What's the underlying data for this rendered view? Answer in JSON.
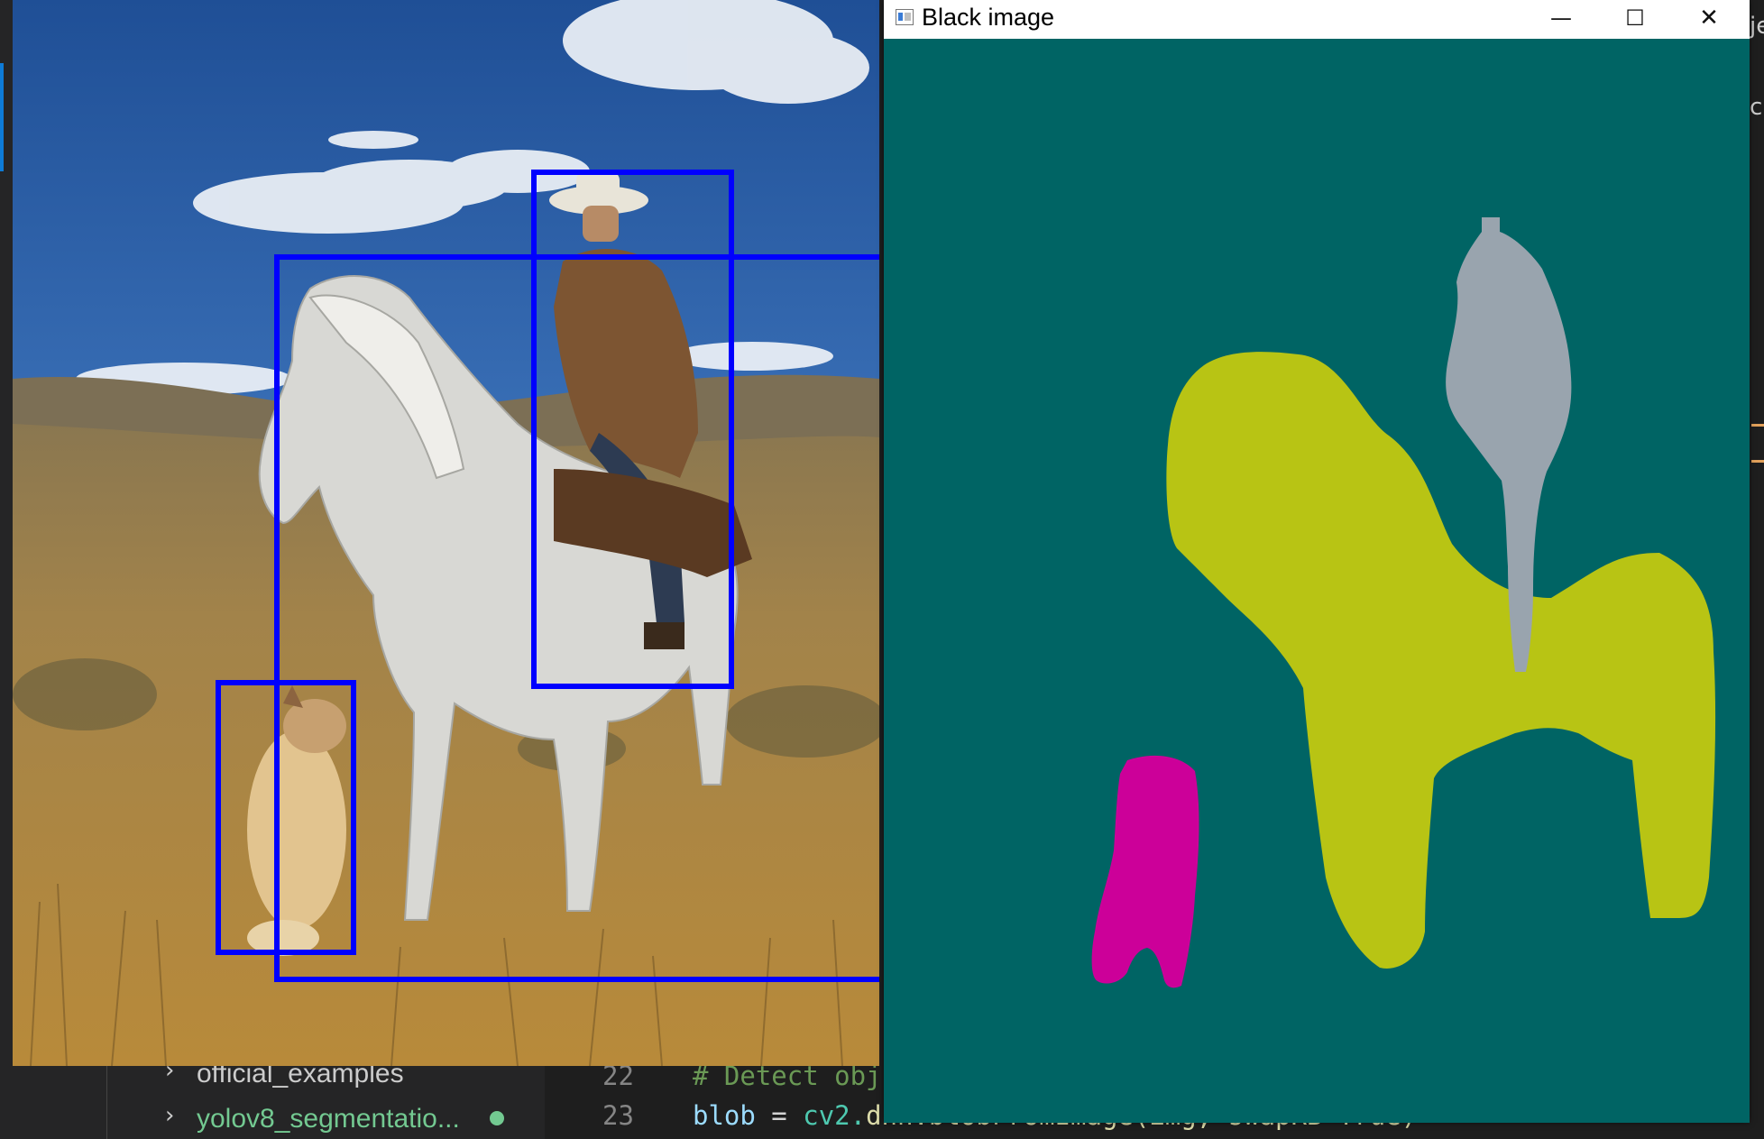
{
  "ide": {
    "explorer_items": [
      {
        "label": "official_examples"
      },
      {
        "label": "yolov8_segmentatio..."
      }
    ],
    "code_lines": [
      {
        "number": "22",
        "text": "# Detect obj"
      },
      {
        "number": "23",
        "text_var": "blob",
        "text_op": " = ",
        "text_mod": "cv2.",
        "text_fn": "dnn.blobFromImage(img, swapRB=True)"
      }
    ],
    "strip_glyph_top": "je",
    "strip_glyph_mid": "c"
  },
  "image_window": {
    "detections": [
      {
        "label": "person",
        "color": "#0000ff"
      },
      {
        "label": "horse",
        "color": "#0000ff"
      },
      {
        "label": "dog",
        "color": "#0000ff"
      }
    ]
  },
  "mask_window": {
    "title": "Black image",
    "buttons": {
      "minimize": "—",
      "maximize": "☐",
      "close": "✕"
    },
    "background_color": "#006464",
    "segments": [
      {
        "label": "horse",
        "color": "#b8c414"
      },
      {
        "label": "person",
        "color": "#99a4ae"
      },
      {
        "label": "dog",
        "color": "#cc0099"
      }
    ]
  }
}
